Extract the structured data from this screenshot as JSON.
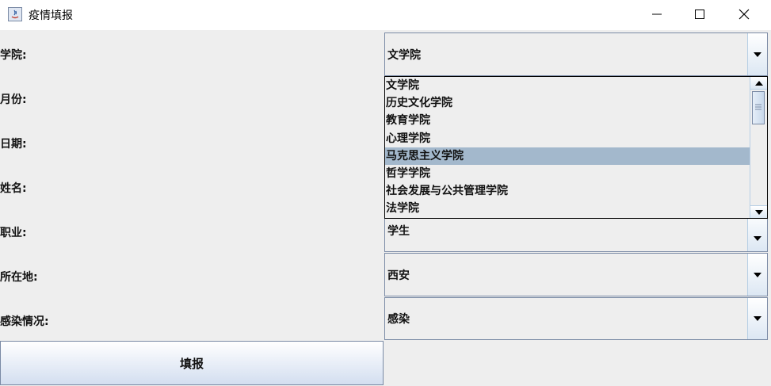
{
  "window": {
    "title": "疫情填报",
    "icon": "java-icon",
    "controls": [
      "minimize",
      "maximize",
      "close"
    ]
  },
  "form": {
    "fields": [
      {
        "label": "学院:",
        "value": "文学院"
      },
      {
        "label": "月份:",
        "value": ""
      },
      {
        "label": "日期:",
        "value": ""
      },
      {
        "label": "姓名:",
        "value": ""
      },
      {
        "label": "职业:",
        "value": "学生"
      },
      {
        "label": "所在地:",
        "value": "西安"
      },
      {
        "label": "感染情况:",
        "value": "感染"
      }
    ],
    "college_dropdown": {
      "open": true,
      "options": [
        "文学院",
        "历史文化学院",
        "教育学院",
        "心理学院",
        "马克思主义学院",
        "哲学学院",
        "社会发展与公共管理学院",
        "法学院"
      ],
      "highlighted": "马克思主义学院"
    },
    "submit_label": "填报"
  },
  "colors": {
    "highlight": "#a3b8cc",
    "border": "#7a8aa5",
    "panel": "#eeeeee"
  }
}
